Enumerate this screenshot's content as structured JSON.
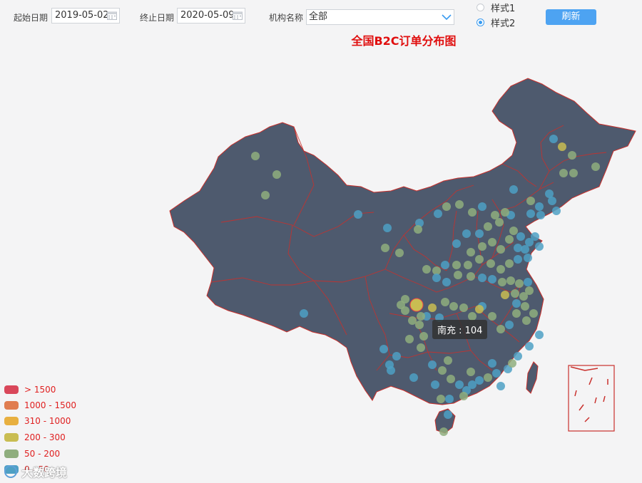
{
  "filters": {
    "start_label": "起始日期",
    "start_value": "2019-05-02",
    "end_label": "终止日期",
    "end_value": "2020-05-09",
    "org_label": "机构名称",
    "org_value": "全部"
  },
  "style_options": [
    {
      "label": "样式1",
      "selected": false
    },
    {
      "label": "样式2",
      "selected": true
    }
  ],
  "refresh_label": "刷新",
  "map_title": "全国B2C订单分布图",
  "tooltip": "南充 : 104",
  "legend": [
    {
      "label": "> 1500",
      "color": "#d9475a"
    },
    {
      "label": "1000 - 1500",
      "color": "#e07d50"
    },
    {
      "label": "310 - 1000",
      "color": "#e8b040"
    },
    {
      "label": "200 - 300",
      "color": "#c9bd52"
    },
    {
      "label": "50 - 200",
      "color": "#8fae7e"
    },
    {
      "label": "0 - 50",
      "color": "#4ea0c4"
    }
  ],
  "watermark": "大数跨境",
  "colors": {
    "map_fill": "#4e5a6e",
    "border": "#c9302c",
    "accent": "#4da3f2",
    "title": "#e00e0e"
  }
}
